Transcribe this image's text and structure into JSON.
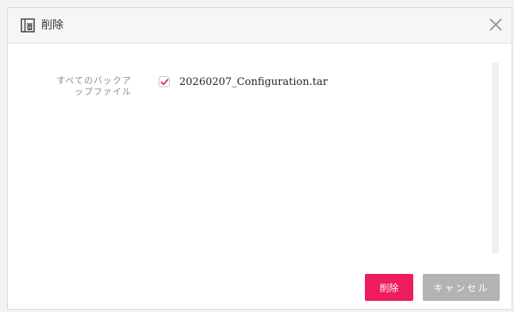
{
  "dialog": {
    "title": "削除",
    "title_icon": "trash-panel-icon",
    "close_icon": "close-icon"
  },
  "form": {
    "label_line1": "すべてのバックア",
    "label_line2": "ップファイル",
    "files": [
      {
        "name": "20260207_Configuration.tar",
        "checked": true
      }
    ]
  },
  "buttons": {
    "delete_label": "削除",
    "cancel_label": "キャンセル"
  },
  "colors": {
    "accent": "#ed1c5a",
    "disabled": "#b3b3b3"
  }
}
